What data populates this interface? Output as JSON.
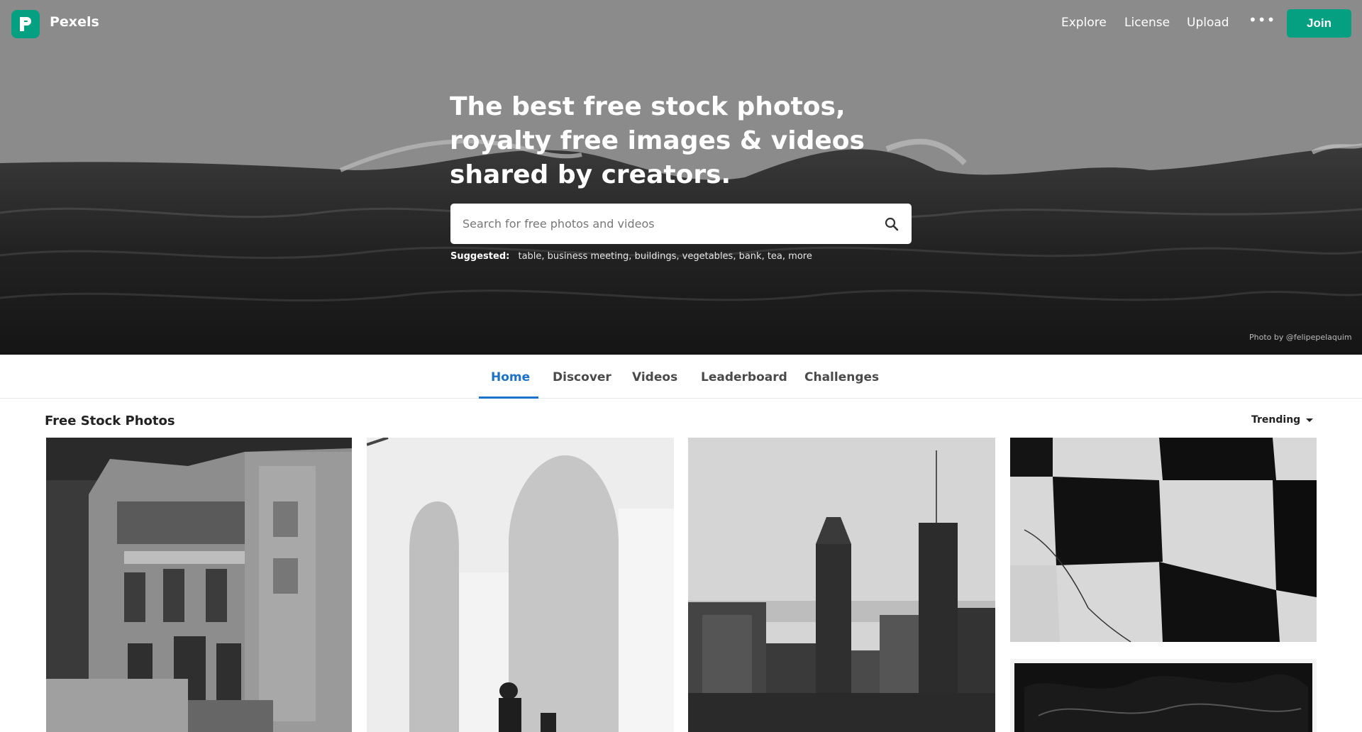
{
  "brand": {
    "name": "Pexels",
    "accent": "#05a081"
  },
  "nav": {
    "links": [
      "Explore",
      "License",
      "Upload"
    ],
    "more_icon": "ellipsis-icon",
    "join_label": "Join"
  },
  "hero": {
    "title": "The best free stock photos, royalty free images & videos shared by creators.",
    "search_placeholder": "Search for free photos and videos",
    "suggested_label": "Suggested:",
    "suggested_items": "table, business meeting, buildings, vegetables, bank, tea, more",
    "credit": "Photo by @felipepelaquim"
  },
  "tabs": {
    "items": [
      "Home",
      "Discover",
      "Videos",
      "Leaderboard",
      "Challenges"
    ],
    "active": "Home",
    "active_color": "#1a73c8"
  },
  "gallery": {
    "title": "Free Stock Photos",
    "sort_label": "Trending"
  }
}
